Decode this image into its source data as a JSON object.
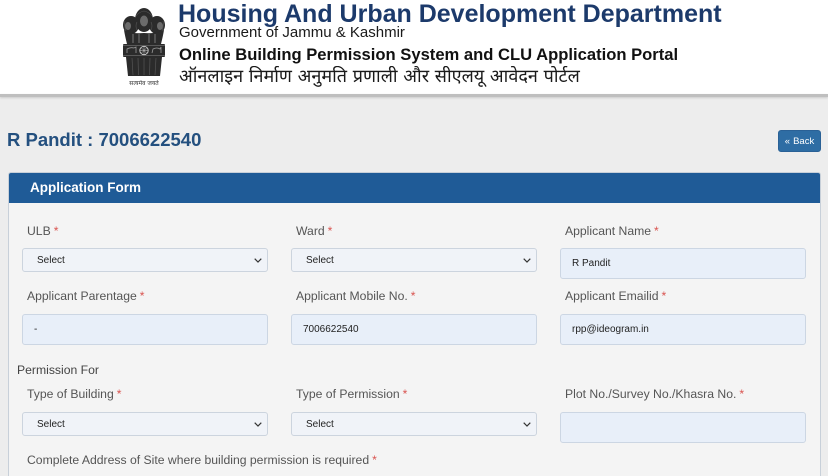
{
  "header": {
    "emblem_icon": "state-emblem-icon",
    "emblem_motto": "सत्यमेव जयते",
    "department": "Housing And Urban Development Department",
    "government": "Government of Jammu & Kashmir",
    "portal_title": "Online Building Permission System and CLU Application Portal",
    "portal_title_hindi": "ऑनलाइन निर्माण अनुमति प्रणाली और सीएलयू आवेदन पोर्टल"
  },
  "applicant_heading": "R Pandit : 7006622540",
  "back_button": {
    "icon": "double-chevron-left-icon",
    "icon_glyph": "«",
    "label": "Back"
  },
  "form": {
    "title": "Application Form",
    "required_marker": "*",
    "dropdown_icon": "chevron-down-icon",
    "fields": {
      "ulb": {
        "label": "ULB",
        "value": "Select"
      },
      "ward": {
        "label": "Ward",
        "value": "Select"
      },
      "applicant_name": {
        "label": "Applicant Name",
        "value": "R Pandit"
      },
      "applicant_parentage": {
        "label": "Applicant Parentage",
        "value": "-"
      },
      "applicant_mobile": {
        "label": "Applicant Mobile No.",
        "value": "7006622540"
      },
      "applicant_email": {
        "label": "Applicant Emailid",
        "value": "rpp@ideogram.in"
      },
      "type_of_building": {
        "label": "Type of Building",
        "value": "Select"
      },
      "type_of_permission": {
        "label": "Type of Permission",
        "value": "Select"
      },
      "plot_no": {
        "label": "Plot No./Survey No./Khasra No.",
        "value": ""
      }
    },
    "permission_section_label": "Permission For",
    "site_address_label": "Complete Address of Site where building permission is required"
  },
  "colors": {
    "department_title": "#1c3a6b",
    "applicant_heading": "#24507f",
    "back_button": "#2e6da4",
    "panel_header": "#1f5b97",
    "required_marker": "#d9534f"
  }
}
